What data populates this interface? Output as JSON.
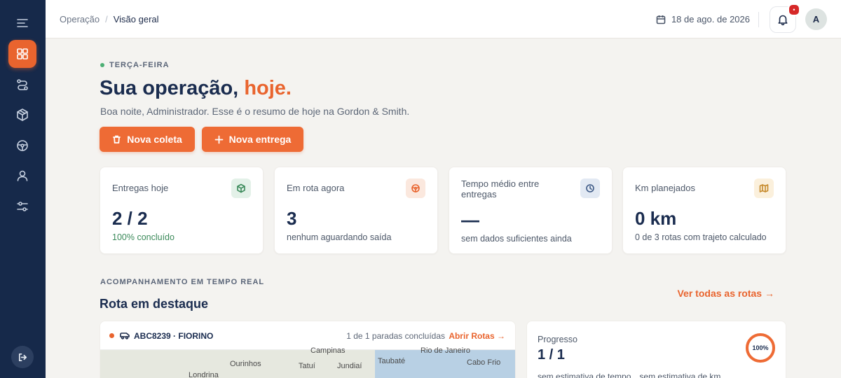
{
  "breadcrumb": {
    "parent": "Operação",
    "separator": "/",
    "current": "Visão geral"
  },
  "topbar": {
    "date": "18 de ago. de 2026",
    "notification_badge": "•",
    "avatar_initial": "A"
  },
  "hero": {
    "weekday": "TERÇA-FEIRA",
    "title_main": "Sua operação,",
    "title_accent": "hoje.",
    "subtitle": "Boa noite, Administrador. Esse é o resumo de hoje na Gordon & Smith.",
    "btn_coleta": "Nova coleta",
    "btn_entrega": "Nova entrega"
  },
  "stats": [
    {
      "label": "Entregas hoje",
      "value": "2 / 2",
      "sub": "100% concluído",
      "icon": "box-icon",
      "color": "#3b8a5a",
      "bg": "#e3f1e8"
    },
    {
      "label": "Em rota agora",
      "value": "3",
      "sub": "nenhum aguardando saída",
      "icon": "steering-icon",
      "color": "#e9642e",
      "bg": "#fbe8de"
    },
    {
      "label": "Tempo médio entre entregas",
      "value": "—",
      "sub": "sem dados suficientes ainda",
      "icon": "clock-icon",
      "color": "#3e5a86",
      "bg": "#e2e9f3"
    },
    {
      "label": "Km planejados",
      "value": "0 km",
      "sub": "0 de 3 rotas com trajeto calculado",
      "icon": "map-icon",
      "color": "#c68a2b",
      "bg": "#fbf0dc"
    }
  ],
  "realtime": {
    "kicker": "ACOMPANHAMENTO EM TEMPO REAL",
    "title": "Rota em destaque",
    "see_all": "Ver todas as rotas →"
  },
  "route": {
    "plate": "ABC8239 · FIORINO",
    "stops": "1 de 1 paradas concluídas",
    "open": "Abrir Rotas →",
    "map_cities": [
      "Campinas",
      "Rio de Janeiro",
      "Ourinhos",
      "Taubaté",
      "Cabo Frio",
      "Tatuí",
      "Jundiaí",
      "Londrina"
    ]
  },
  "progress": {
    "label": "Progresso",
    "value": "1 / 1",
    "percent": "100%",
    "time_note": "sem estimativa de tempo",
    "km_note": "sem estimativa de km"
  },
  "sidebar": {
    "items": [
      "menu-icon",
      "dashboard-icon",
      "routes-icon",
      "package-icon",
      "steering-icon",
      "user-icon",
      "settings-icon"
    ]
  }
}
